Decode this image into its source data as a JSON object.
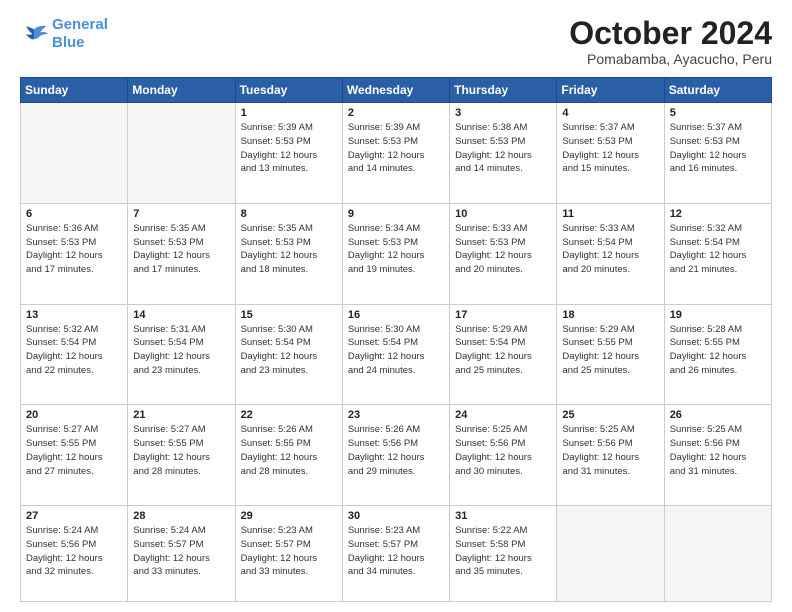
{
  "logo": {
    "line1": "General",
    "line2": "Blue"
  },
  "title": "October 2024",
  "location": "Pomabamba, Ayacucho, Peru",
  "weekdays": [
    "Sunday",
    "Monday",
    "Tuesday",
    "Wednesday",
    "Thursday",
    "Friday",
    "Saturday"
  ],
  "weeks": [
    [
      {
        "day": "",
        "info": ""
      },
      {
        "day": "",
        "info": ""
      },
      {
        "day": "1",
        "info": "Sunrise: 5:39 AM\nSunset: 5:53 PM\nDaylight: 12 hours\nand 13 minutes."
      },
      {
        "day": "2",
        "info": "Sunrise: 5:39 AM\nSunset: 5:53 PM\nDaylight: 12 hours\nand 14 minutes."
      },
      {
        "day": "3",
        "info": "Sunrise: 5:38 AM\nSunset: 5:53 PM\nDaylight: 12 hours\nand 14 minutes."
      },
      {
        "day": "4",
        "info": "Sunrise: 5:37 AM\nSunset: 5:53 PM\nDaylight: 12 hours\nand 15 minutes."
      },
      {
        "day": "5",
        "info": "Sunrise: 5:37 AM\nSunset: 5:53 PM\nDaylight: 12 hours\nand 16 minutes."
      }
    ],
    [
      {
        "day": "6",
        "info": "Sunrise: 5:36 AM\nSunset: 5:53 PM\nDaylight: 12 hours\nand 17 minutes."
      },
      {
        "day": "7",
        "info": "Sunrise: 5:35 AM\nSunset: 5:53 PM\nDaylight: 12 hours\nand 17 minutes."
      },
      {
        "day": "8",
        "info": "Sunrise: 5:35 AM\nSunset: 5:53 PM\nDaylight: 12 hours\nand 18 minutes."
      },
      {
        "day": "9",
        "info": "Sunrise: 5:34 AM\nSunset: 5:53 PM\nDaylight: 12 hours\nand 19 minutes."
      },
      {
        "day": "10",
        "info": "Sunrise: 5:33 AM\nSunset: 5:53 PM\nDaylight: 12 hours\nand 20 minutes."
      },
      {
        "day": "11",
        "info": "Sunrise: 5:33 AM\nSunset: 5:54 PM\nDaylight: 12 hours\nand 20 minutes."
      },
      {
        "day": "12",
        "info": "Sunrise: 5:32 AM\nSunset: 5:54 PM\nDaylight: 12 hours\nand 21 minutes."
      }
    ],
    [
      {
        "day": "13",
        "info": "Sunrise: 5:32 AM\nSunset: 5:54 PM\nDaylight: 12 hours\nand 22 minutes."
      },
      {
        "day": "14",
        "info": "Sunrise: 5:31 AM\nSunset: 5:54 PM\nDaylight: 12 hours\nand 23 minutes."
      },
      {
        "day": "15",
        "info": "Sunrise: 5:30 AM\nSunset: 5:54 PM\nDaylight: 12 hours\nand 23 minutes."
      },
      {
        "day": "16",
        "info": "Sunrise: 5:30 AM\nSunset: 5:54 PM\nDaylight: 12 hours\nand 24 minutes."
      },
      {
        "day": "17",
        "info": "Sunrise: 5:29 AM\nSunset: 5:54 PM\nDaylight: 12 hours\nand 25 minutes."
      },
      {
        "day": "18",
        "info": "Sunrise: 5:29 AM\nSunset: 5:55 PM\nDaylight: 12 hours\nand 25 minutes."
      },
      {
        "day": "19",
        "info": "Sunrise: 5:28 AM\nSunset: 5:55 PM\nDaylight: 12 hours\nand 26 minutes."
      }
    ],
    [
      {
        "day": "20",
        "info": "Sunrise: 5:27 AM\nSunset: 5:55 PM\nDaylight: 12 hours\nand 27 minutes."
      },
      {
        "day": "21",
        "info": "Sunrise: 5:27 AM\nSunset: 5:55 PM\nDaylight: 12 hours\nand 28 minutes."
      },
      {
        "day": "22",
        "info": "Sunrise: 5:26 AM\nSunset: 5:55 PM\nDaylight: 12 hours\nand 28 minutes."
      },
      {
        "day": "23",
        "info": "Sunrise: 5:26 AM\nSunset: 5:56 PM\nDaylight: 12 hours\nand 29 minutes."
      },
      {
        "day": "24",
        "info": "Sunrise: 5:25 AM\nSunset: 5:56 PM\nDaylight: 12 hours\nand 30 minutes."
      },
      {
        "day": "25",
        "info": "Sunrise: 5:25 AM\nSunset: 5:56 PM\nDaylight: 12 hours\nand 31 minutes."
      },
      {
        "day": "26",
        "info": "Sunrise: 5:25 AM\nSunset: 5:56 PM\nDaylight: 12 hours\nand 31 minutes."
      }
    ],
    [
      {
        "day": "27",
        "info": "Sunrise: 5:24 AM\nSunset: 5:56 PM\nDaylight: 12 hours\nand 32 minutes."
      },
      {
        "day": "28",
        "info": "Sunrise: 5:24 AM\nSunset: 5:57 PM\nDaylight: 12 hours\nand 33 minutes."
      },
      {
        "day": "29",
        "info": "Sunrise: 5:23 AM\nSunset: 5:57 PM\nDaylight: 12 hours\nand 33 minutes."
      },
      {
        "day": "30",
        "info": "Sunrise: 5:23 AM\nSunset: 5:57 PM\nDaylight: 12 hours\nand 34 minutes."
      },
      {
        "day": "31",
        "info": "Sunrise: 5:22 AM\nSunset: 5:58 PM\nDaylight: 12 hours\nand 35 minutes."
      },
      {
        "day": "",
        "info": ""
      },
      {
        "day": "",
        "info": ""
      }
    ]
  ]
}
